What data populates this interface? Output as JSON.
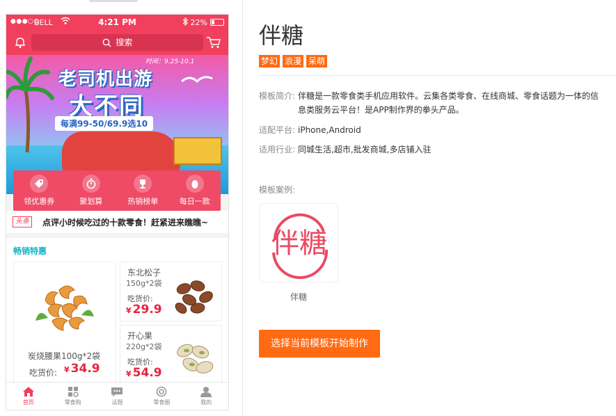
{
  "phone": {
    "status": {
      "signal": "●●●○○",
      "carrier": "BELL",
      "time": "4:21 PM",
      "battery": "22%"
    },
    "appbar": {
      "search_placeholder": "搜索"
    },
    "banner": {
      "title_line1": "老司机出游",
      "title_line2": "大不同",
      "date": "时间：9.25-10.1",
      "promo": "每满99-50/69.9选10"
    },
    "quick_nav": [
      {
        "label": "领优惠券",
        "icon": "coupon-icon"
      },
      {
        "label": "聚划算",
        "icon": "stopwatch-icon"
      },
      {
        "label": "热销榜单",
        "icon": "trophy-icon"
      },
      {
        "label": "每日一款",
        "icon": "egg-icon"
      }
    ],
    "headline": {
      "tag": "头条",
      "text": "点评小时候吃过的十款零食！赶紧进来瞧瞧~"
    },
    "section": {
      "title": "畅销特惠",
      "big_product": {
        "name": "炭烧腰果100g*2袋",
        "price_label": "吃货价:",
        "currency": "¥",
        "price": "34.9"
      },
      "products": [
        {
          "name": "东北松子",
          "weight": "150g*2袋",
          "price_label": "吃货价:",
          "currency": "¥",
          "price": "29.9"
        },
        {
          "name": "开心果",
          "weight": "220g*2袋",
          "price_label": "吃货价:",
          "currency": "¥",
          "price": "54.9"
        }
      ]
    },
    "tabbar": [
      {
        "label": "首页",
        "icon": "home-icon",
        "active": true
      },
      {
        "label": "零食购",
        "icon": "grid-icon",
        "active": false
      },
      {
        "label": "话题",
        "icon": "chat-icon",
        "active": false
      },
      {
        "label": "零食圈",
        "icon": "target-icon",
        "active": false
      },
      {
        "label": "我的",
        "icon": "user-icon",
        "active": false
      }
    ]
  },
  "detail": {
    "title": "伴糖",
    "tags": [
      "梦幻",
      "浪漫",
      "呆萌"
    ],
    "intro_label": "模板简介:",
    "intro_text": "伴糖是一款零食类手机应用软件。云集各类零食、在线商城、零食话题为一体的信息类服务云平台！是APP制作界的拳头产品。",
    "platform_label": "适配平台:",
    "platform_value": "iPhone,Android",
    "industry_label": "适用行业:",
    "industry_value": "同城生活,超市,批发商城,多店铺入驻",
    "cases_label": "模板案例:",
    "case_logo_text": "伴糖",
    "case_name": "伴糖",
    "cta_label": "选择当前模板开始制作"
  },
  "colors": {
    "brand_red": "#f0405d",
    "accent_orange": "#ff6a13",
    "section_teal": "#15b3c7",
    "price_red": "#e8243f"
  }
}
